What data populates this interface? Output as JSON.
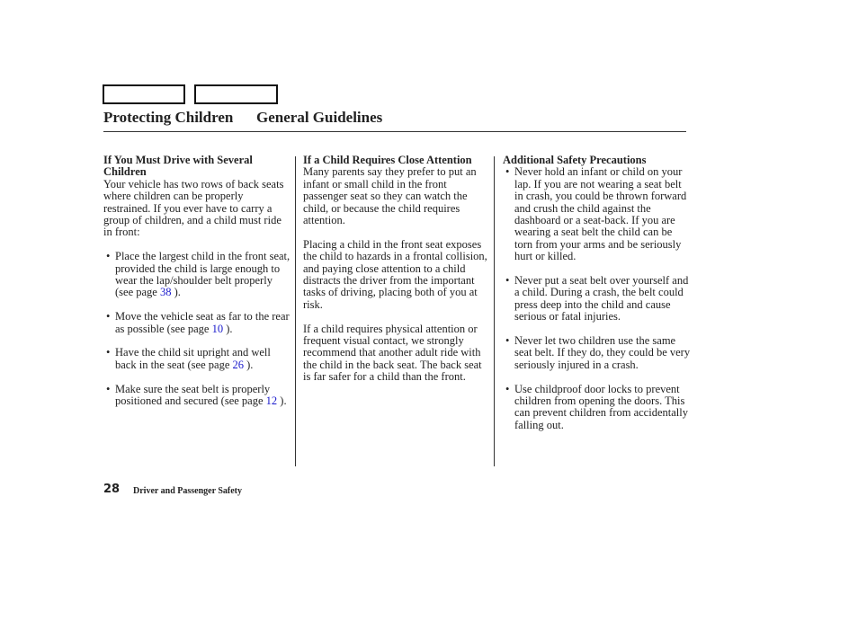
{
  "nav": {
    "box1": "",
    "box2": ""
  },
  "header": {
    "section": "Protecting Children",
    "topic": "General Guidelines"
  },
  "col1": {
    "heading": "If You Must Drive with Several Children",
    "intro": "Your vehicle has two rows of back seats where children can be properly restrained. If you ever have to carry a group of children, and a child must ride in front:",
    "bullets": [
      {
        "text": "Place the largest child in the front seat, provided the child is large enough to wear the lap/shoulder belt properly (see page ",
        "page": "38",
        "end": " )."
      },
      {
        "text": "Move the vehicle seat as far to the rear as possible (see page ",
        "page": "10",
        "end": " )."
      },
      {
        "text": "Have the child sit upright and well back in the seat (see page ",
        "page": "26",
        "end": " )."
      },
      {
        "text": "Make sure the seat belt is properly positioned and secured (see page ",
        "page": "12",
        "end": " )."
      }
    ]
  },
  "col2": {
    "heading": "If a Child Requires Close Attention",
    "paragraphs": [
      "Many parents say they prefer to put an infant or small child in the front passenger seat so they can watch the child, or because the child requires attention.",
      "Placing a child in the front seat exposes the child to hazards in a frontal collision, and paying close attention to a child distracts the driver from the important tasks of driving, placing both of you at risk.",
      "If a child requires physical attention or frequent visual contact, we strongly recommend that another adult ride with the child in the back seat. The back seat is far safer for a child than the front."
    ]
  },
  "col3": {
    "heading": "Additional Safety Precautions",
    "bullets": [
      "Never hold an infant or child on your lap. If you are not wearing a seat belt in crash, you could be thrown forward and crush the child against the dashboard or a seat-back. If you are wearing a seat belt the child can be torn from your arms and be seriously hurt or killed.",
      "Never put a seat belt over yourself and a child. During a crash, the belt could press deep into the child and cause serious or fatal injuries.",
      "Never let two children use the same seat belt. If they do, they could be very seriously injured in a crash.",
      "Use childproof door locks to prevent children from opening the doors. This can prevent children from accidentally falling out."
    ]
  },
  "footer": {
    "page_number": "28",
    "chapter": "Driver and Passenger Safety"
  },
  "bullet_glyph": "•",
  "colors": {
    "link": "#1a1acc",
    "text": "#222222"
  }
}
